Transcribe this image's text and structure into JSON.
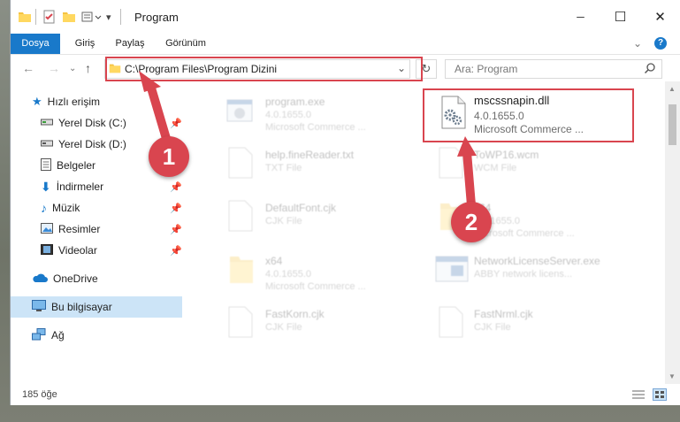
{
  "window": {
    "title": "Program",
    "controls": {
      "minimize": "─",
      "maximize": "☐",
      "close": "✕"
    }
  },
  "ribbon": {
    "tabs": [
      "Dosya",
      "Giriş",
      "Paylaş",
      "Görünüm"
    ],
    "collapse_icon": "⌄",
    "help_icon": "?"
  },
  "address": {
    "path": "C:\\Program Files\\Program Dizini",
    "dropdown_glyph": "⌄",
    "refresh_glyph": "↻"
  },
  "search": {
    "placeholder": "Ara: Program"
  },
  "sidebar": {
    "items": [
      {
        "label": "Hızlı erişim",
        "icon": "star-icon",
        "pinned": false
      },
      {
        "label": "Yerel Disk (C:)",
        "icon": "drive-icon",
        "pinned": true
      },
      {
        "label": "Yerel Disk (D:)",
        "icon": "drive-icon",
        "pinned": true
      },
      {
        "label": "Belgeler",
        "icon": "document-icon",
        "pinned": true
      },
      {
        "label": "İndirmeler",
        "icon": "download-icon",
        "pinned": true
      },
      {
        "label": "Müzik",
        "icon": "music-icon",
        "pinned": true
      },
      {
        "label": "Resimler",
        "icon": "pictures-icon",
        "pinned": true
      },
      {
        "label": "Videolar",
        "icon": "video-icon",
        "pinned": true
      },
      {
        "label": "OneDrive",
        "icon": "cloud-icon",
        "pinned": false
      },
      {
        "label": "Bu bilgisayar",
        "icon": "computer-icon",
        "pinned": false
      },
      {
        "label": "Ağ",
        "icon": "network-icon",
        "pinned": false
      }
    ]
  },
  "files": [
    {
      "name": "program.exe",
      "line1": "4.0.1655.0",
      "line2": "Microsoft Commerce ...",
      "icon": "exe-icon",
      "highlighted": false
    },
    {
      "name": "mscssnapin.dll",
      "line1": "4.0.1655.0",
      "line2": "Microsoft Commerce ...",
      "icon": "dll-icon",
      "highlighted": true
    },
    {
      "name": "help.fineReader.txt",
      "line1": "TXT File",
      "line2": "",
      "icon": "txt-icon",
      "highlighted": false
    },
    {
      "name": "ToWP16.wcm",
      "line1": "WCM File",
      "line2": "",
      "icon": "file-icon",
      "highlighted": false
    },
    {
      "name": "DefaultFont.cjk",
      "line1": "CJK File",
      "line2": "",
      "icon": "file-icon",
      "highlighted": false
    },
    {
      "name": "x64",
      "line1": "4.0.1655.0",
      "line2": "Microsoft Commerce ...",
      "icon": "folder-icon",
      "highlighted": false
    },
    {
      "name": "x64",
      "line1": "4.0.1655.0",
      "line2": "Microsoft Commerce ...",
      "icon": "folder-icon",
      "highlighted": false
    },
    {
      "name": "NetworkLicenseServer.exe",
      "line1": "ABBY network licens...",
      "line2": "",
      "icon": "exe-icon",
      "highlighted": false
    },
    {
      "name": "FastKorn.cjk",
      "line1": "CJK File",
      "line2": "",
      "icon": "file-icon",
      "highlighted": false
    },
    {
      "name": "FastNrml.cjk",
      "line1": "CJK File",
      "line2": "",
      "icon": "file-icon",
      "highlighted": false
    }
  ],
  "status": {
    "count_text": "185 öğe"
  },
  "callouts": [
    "1",
    "2"
  ],
  "colors": {
    "accent": "#1979ca",
    "highlight": "#d9454f",
    "selected": "#cce4f7"
  }
}
